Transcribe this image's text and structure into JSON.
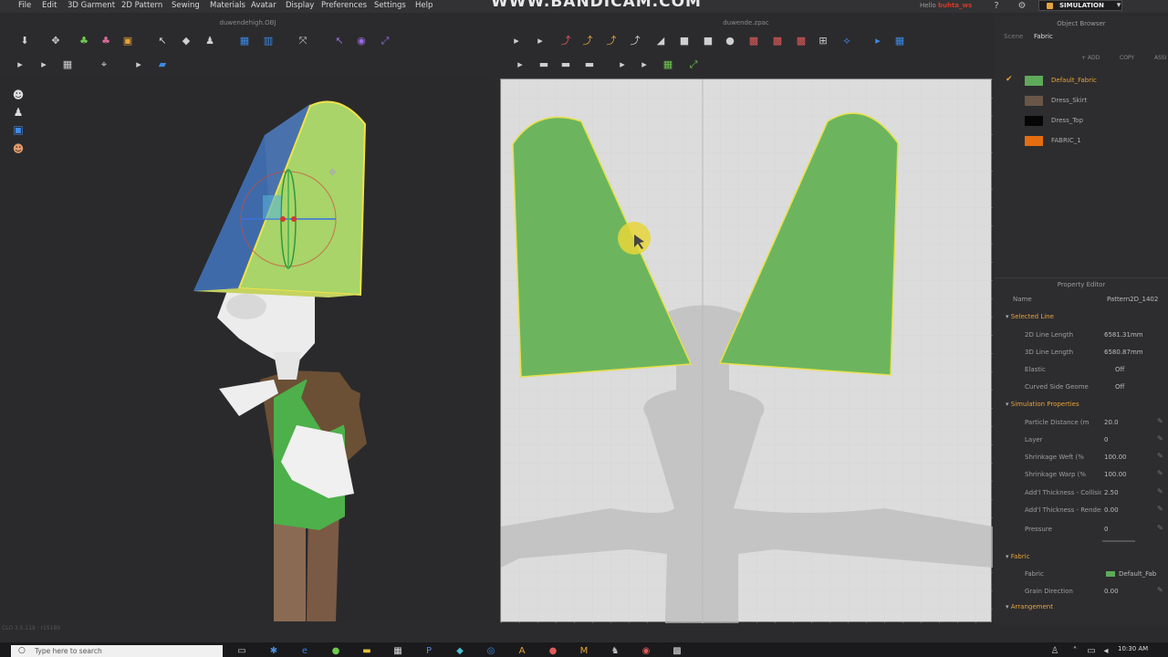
{
  "menu": [
    "File",
    "Edit",
    "3D Garment",
    "2D Pattern",
    "Sewing",
    "Materials",
    "Avatar",
    "Display",
    "Preferences",
    "Settings",
    "Help"
  ],
  "watermark": "WWW.BANDICAM.COM",
  "user": {
    "hello": "Hello",
    "name": "buhta_ws"
  },
  "simulation_label": "SIMULATION",
  "window_titles": {
    "left": "duwendehigh.OBJ",
    "right": "duwende.zpac"
  },
  "object_browser": {
    "title": "Object Browser",
    "tabs": [
      "Scene",
      "Fabric"
    ],
    "active_tab": "Fabric",
    "actions": [
      "+ ADD",
      "COPY",
      "ASSI"
    ],
    "fabrics": [
      {
        "name": "Default_Fabric",
        "color": "#5fa95a",
        "checked": true
      },
      {
        "name": "Dress_Skirt",
        "color": "#6a5648",
        "checked": false
      },
      {
        "name": "Dress_Top",
        "color": "#060606",
        "checked": false
      },
      {
        "name": "FABRIC_1",
        "color": "#e46d10",
        "checked": false
      }
    ]
  },
  "property_editor": {
    "title": "Property Editor",
    "name_label": "Name",
    "name_value": "Pattern2D_1402",
    "sections": {
      "selected_line": "Selected Line",
      "simulation": "Simulation Properties",
      "fabric": "Fabric",
      "arrangement": "Arrangement"
    },
    "selected_line": [
      {
        "label": "2D Line Length",
        "value": "6581.31mm"
      },
      {
        "label": "3D Line Length",
        "value": "6580.87mm"
      },
      {
        "label": "Elastic",
        "value": "Off"
      },
      {
        "label": "Curved Side Geome",
        "value": "Off"
      }
    ],
    "simulation": [
      {
        "label": "Particle Distance (m",
        "value": "20.0"
      },
      {
        "label": "Layer",
        "value": "0"
      },
      {
        "label": "Shrinkage Weft (%",
        "value": "100.00"
      },
      {
        "label": "Shrinkage Warp (%",
        "value": "100.00"
      },
      {
        "label": "Add'l Thickness - Collisio",
        "value": "2.50"
      },
      {
        "label": "Add'l Thickness - Renderi",
        "value": "0.00"
      },
      {
        "label": "Pressure",
        "value": "0"
      }
    ],
    "fabric": [
      {
        "label": "Fabric",
        "value": "Default_Fab"
      },
      {
        "label": "Grain Direction",
        "value": "0.00"
      }
    ]
  },
  "status_text": "CLO 3.5.118 · r15189",
  "taskbar": {
    "search_placeholder": "Type here to search",
    "time": "10:30 AM"
  }
}
